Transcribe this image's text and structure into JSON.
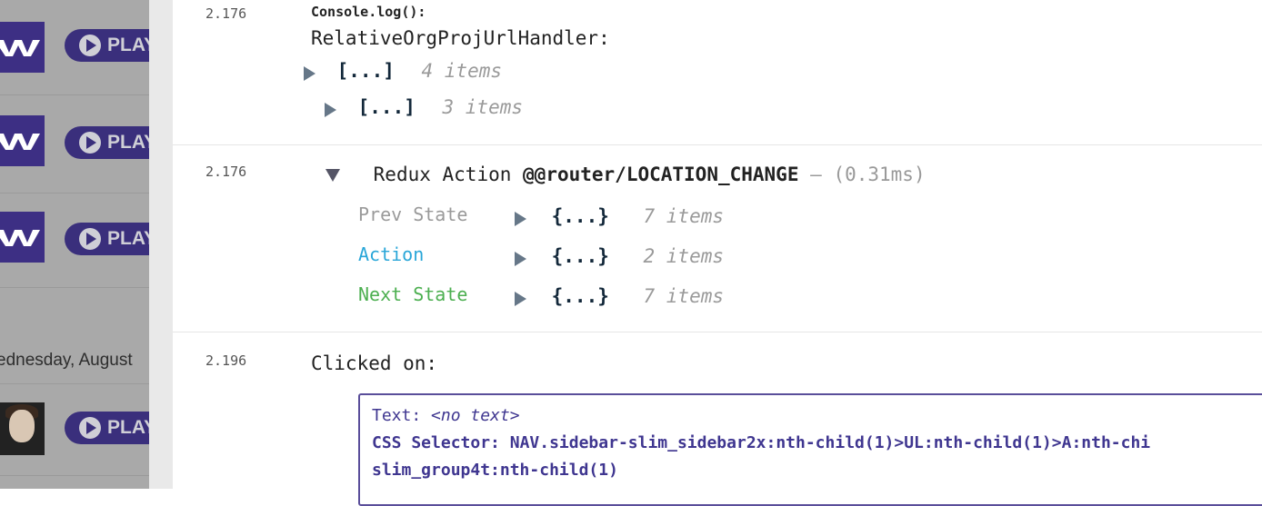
{
  "background_app": {
    "play_label": "PLAY",
    "date_text": "ednesday, August",
    "colors": {
      "brand_purple": "#3d2f84",
      "overlay_gray": "#a9a9a9"
    }
  },
  "console": {
    "entries": [
      {
        "timestamp": "2.176",
        "header": "Console.log():",
        "message": "RelativeOrgProjUrlHandler:",
        "items": [
          {
            "preview": "[...]",
            "count": "4 items"
          },
          {
            "preview": "[...]",
            "count": "3 items"
          }
        ]
      },
      {
        "timestamp": "2.176",
        "title_prefix": "Redux Action",
        "action_type": "@@router/LOCATION_CHANGE",
        "separator": "—",
        "duration": "(0.31ms)",
        "rows": [
          {
            "label": "Prev State",
            "preview": "{...}",
            "count": "7 items",
            "color": "#9a9a9a"
          },
          {
            "label": "Action",
            "preview": "{...}",
            "count": "2 items",
            "color": "#29a6d8"
          },
          {
            "label": "Next State",
            "preview": "{...}",
            "count": "7 items",
            "color": "#4caf50"
          }
        ]
      },
      {
        "timestamp": "2.196",
        "message": "Clicked on:",
        "text_label": "Text:",
        "text_value": "<no text>",
        "css_label": "CSS Selector:",
        "css_value": "NAV.sidebar-slim_sidebar2x:nth-child(1)>UL:nth-child(1)>A:nth-chi",
        "css_value_cont": "slim_group4t:nth-child(1)"
      }
    ]
  }
}
